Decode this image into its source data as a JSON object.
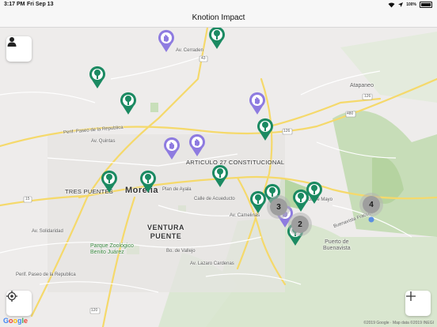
{
  "status_bar": {
    "time": "3:17 PM",
    "date": "Fri Sep 13",
    "battery": "100%"
  },
  "nav": {
    "title": "Knotion Impact"
  },
  "map": {
    "labels": {
      "morelia": "Morelia",
      "ventura_puente": "VENTURA\nPUENTE",
      "articulo_27": "ARTICULO 27\nCONSTITUCIONAL",
      "tres_puentes": "TRES PUENTES",
      "atapaneo": "Atapaneo",
      "puerto_buenavista": "Puerto de\nBuenavista",
      "parque_zoologico": "Parque Zoológico\nBenito Juárez",
      "perif_republica": "Perif. Paseo de la Republica",
      "perif_republica_2": "Perif. Paseo de la Republica",
      "av_quintas": "Av. Quintas",
      "plan_de_ayala": "Plan de Ayala",
      "calle_acueducto": "Calle de Acueducto",
      "av_cerraden": "Av. Cerraden",
      "av_solidaridad": "Av. Solidaridad",
      "bo_de_vallejo": "Bo. de Vallejo",
      "av_lazaro": "Av. Lazaro Cardenas",
      "av_camelinas": "Av. Camelinas",
      "ahuatlan": "Buenavista Fraccion",
      "highway_43": "43",
      "highway_126": "126",
      "highway_126b": "126",
      "highway_480": "480",
      "highway_15": "15",
      "highway_15b": "15",
      "highway_120": "120",
      "ahuhato": "Cinco de Mayo"
    },
    "clusters": [
      {
        "count": "3"
      },
      {
        "count": "2"
      },
      {
        "count": "4"
      }
    ],
    "colors": {
      "tree_pin": "#1b8a62",
      "user_pin": "#8e7be0",
      "cluster": "#9e9e9e"
    }
  },
  "controls": {
    "profile_icon": "person-icon",
    "locate_icon": "crosshair-icon",
    "add_icon": "plus-icon"
  },
  "attribution": {
    "text": "©2019 Google · Map data ©2019 INEGI",
    "logo": "Google"
  }
}
